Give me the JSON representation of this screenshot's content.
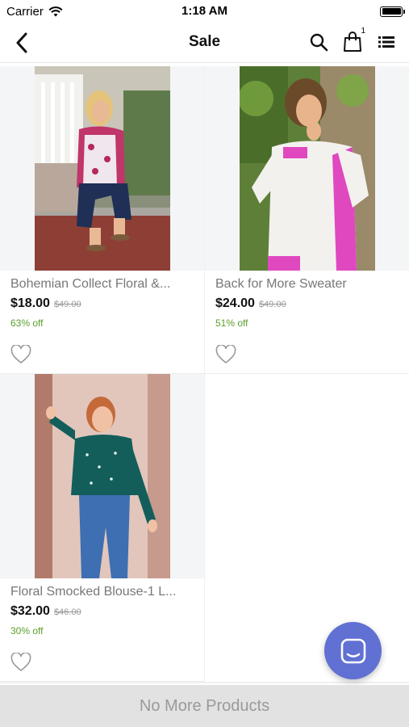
{
  "status_bar": {
    "carrier": "Carrier",
    "time": "1:18 AM"
  },
  "nav": {
    "title": "Sale",
    "cart_count": "1",
    "icons": [
      "back-chevron-icon",
      "search-icon",
      "shopping-bag-icon",
      "list-menu-icon"
    ]
  },
  "products": [
    {
      "title": "Bohemian Collect Floral &...",
      "price": "$18.00",
      "original_price": "$49.00",
      "discount": "63% off",
      "image": "photo-woman-floral-blouse-sitting"
    },
    {
      "title": "Back for More Sweater",
      "price": "$24.00",
      "original_price": "$49.00",
      "discount": "51% off",
      "image": "photo-woman-white-pink-sweater"
    },
    {
      "title": "Floral Smocked Blouse-1 L...",
      "price": "$32.00",
      "original_price": "$46.00",
      "discount": "30% off",
      "image": "photo-woman-teal-blouse-doorway"
    }
  ],
  "footer": {
    "text": "No More Products"
  },
  "colors": {
    "discount_green": "#5aa02c",
    "chat_fab": "#6070d3",
    "footer_bg": "#e2e2e2"
  }
}
